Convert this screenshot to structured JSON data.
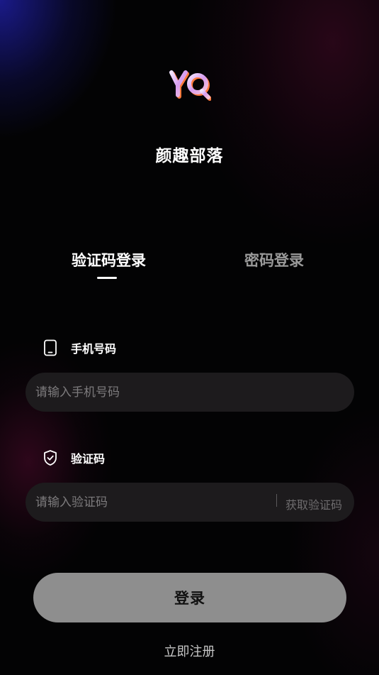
{
  "brand": {
    "logo_text": "YQ",
    "app_name": "颜趣部落"
  },
  "tabs": [
    {
      "label": "验证码登录",
      "active": true
    },
    {
      "label": "密码登录",
      "active": false
    }
  ],
  "phone_field": {
    "label": "手机号码",
    "icon": "phone-icon",
    "placeholder": "请输入手机号码",
    "value": ""
  },
  "code_field": {
    "label": "验证码",
    "icon": "shield-check-icon",
    "placeholder": "请输入验证码",
    "value": "",
    "get_code_label": "获取验证码"
  },
  "actions": {
    "login_label": "登录",
    "register_label": "立即注册"
  },
  "colors": {
    "background": "#030304",
    "input_bg": "#1d1b1d",
    "button_bg": "#8e8e8e",
    "logo_gradient": [
      "#f0d9ff",
      "#c986e8",
      "#ff7d4a"
    ]
  }
}
